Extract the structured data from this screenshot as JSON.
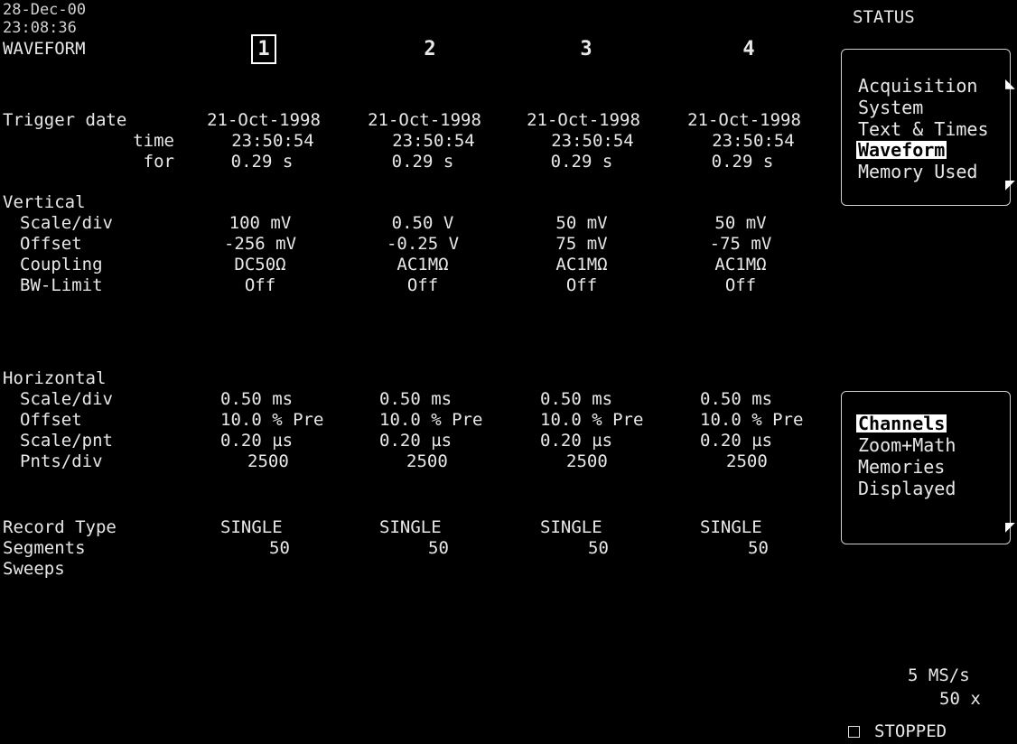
{
  "header": {
    "date": "28-Dec-00",
    "time": "23:08:36",
    "section": "WAVEFORM",
    "status_title": "STATUS"
  },
  "columns": [
    "1",
    "2",
    "3",
    "4"
  ],
  "trigger": {
    "labels": {
      "date": "Trigger date",
      "time": "time",
      "for": "for"
    },
    "dates": [
      "21-Oct-1998",
      "21-Oct-1998",
      "21-Oct-1998",
      "21-Oct-1998"
    ],
    "times": [
      "23:50:54",
      "23:50:54",
      "23:50:54",
      "23:50:54"
    ],
    "durations": [
      "0.29 s",
      "0.29 s",
      "0.29 s",
      "0.29 s"
    ]
  },
  "vertical": {
    "title": "Vertical",
    "labels": [
      "Scale/div",
      "Offset",
      "Coupling",
      "BW-Limit"
    ],
    "scale": [
      "100 mV",
      "0.50 V",
      "50 mV",
      "50 mV"
    ],
    "offset": [
      "-256 mV",
      "-0.25 V",
      "75 mV",
      "-75 mV"
    ],
    "coupling": [
      "DC50Ω",
      "AC1MΩ",
      "AC1MΩ",
      "AC1MΩ"
    ],
    "bw_limit": [
      "Off",
      "Off",
      "Off",
      "Off"
    ]
  },
  "horizontal": {
    "title": "Horizontal",
    "labels": [
      "Scale/div",
      "Offset",
      "Scale/pnt",
      "Pnts/div"
    ],
    "scale": [
      "0.50 ms",
      "0.50 ms",
      "0.50 ms",
      "0.50 ms"
    ],
    "offset": [
      "10.0 % Pre",
      "10.0 % Pre",
      "10.0 % Pre",
      "10.0 % Pre"
    ],
    "scale_pnt": [
      "0.20 µs",
      "0.20 µs",
      "0.20 µs",
      "0.20 µs"
    ],
    "pnts_div": [
      "2500",
      "2500",
      "2500",
      "2500"
    ]
  },
  "record": {
    "labels": [
      "Record Type",
      "Segments",
      "Sweeps"
    ],
    "type": [
      "SINGLE",
      "SINGLE",
      "SINGLE",
      "SINGLE"
    ],
    "segments": [
      "50",
      "50",
      "50",
      "50"
    ]
  },
  "status_menu": {
    "items": [
      "Acquisition",
      "System",
      "Text & Times",
      "Waveform",
      "Memory Used"
    ],
    "selected": "Waveform"
  },
  "source_menu": {
    "items": [
      "Channels",
      "Zoom+Math",
      "Memories",
      "Displayed"
    ],
    "selected": "Channels"
  },
  "acquisition": {
    "sample_rate": "5 MS/s",
    "segments_x": "50 x",
    "state": "STOPPED"
  }
}
